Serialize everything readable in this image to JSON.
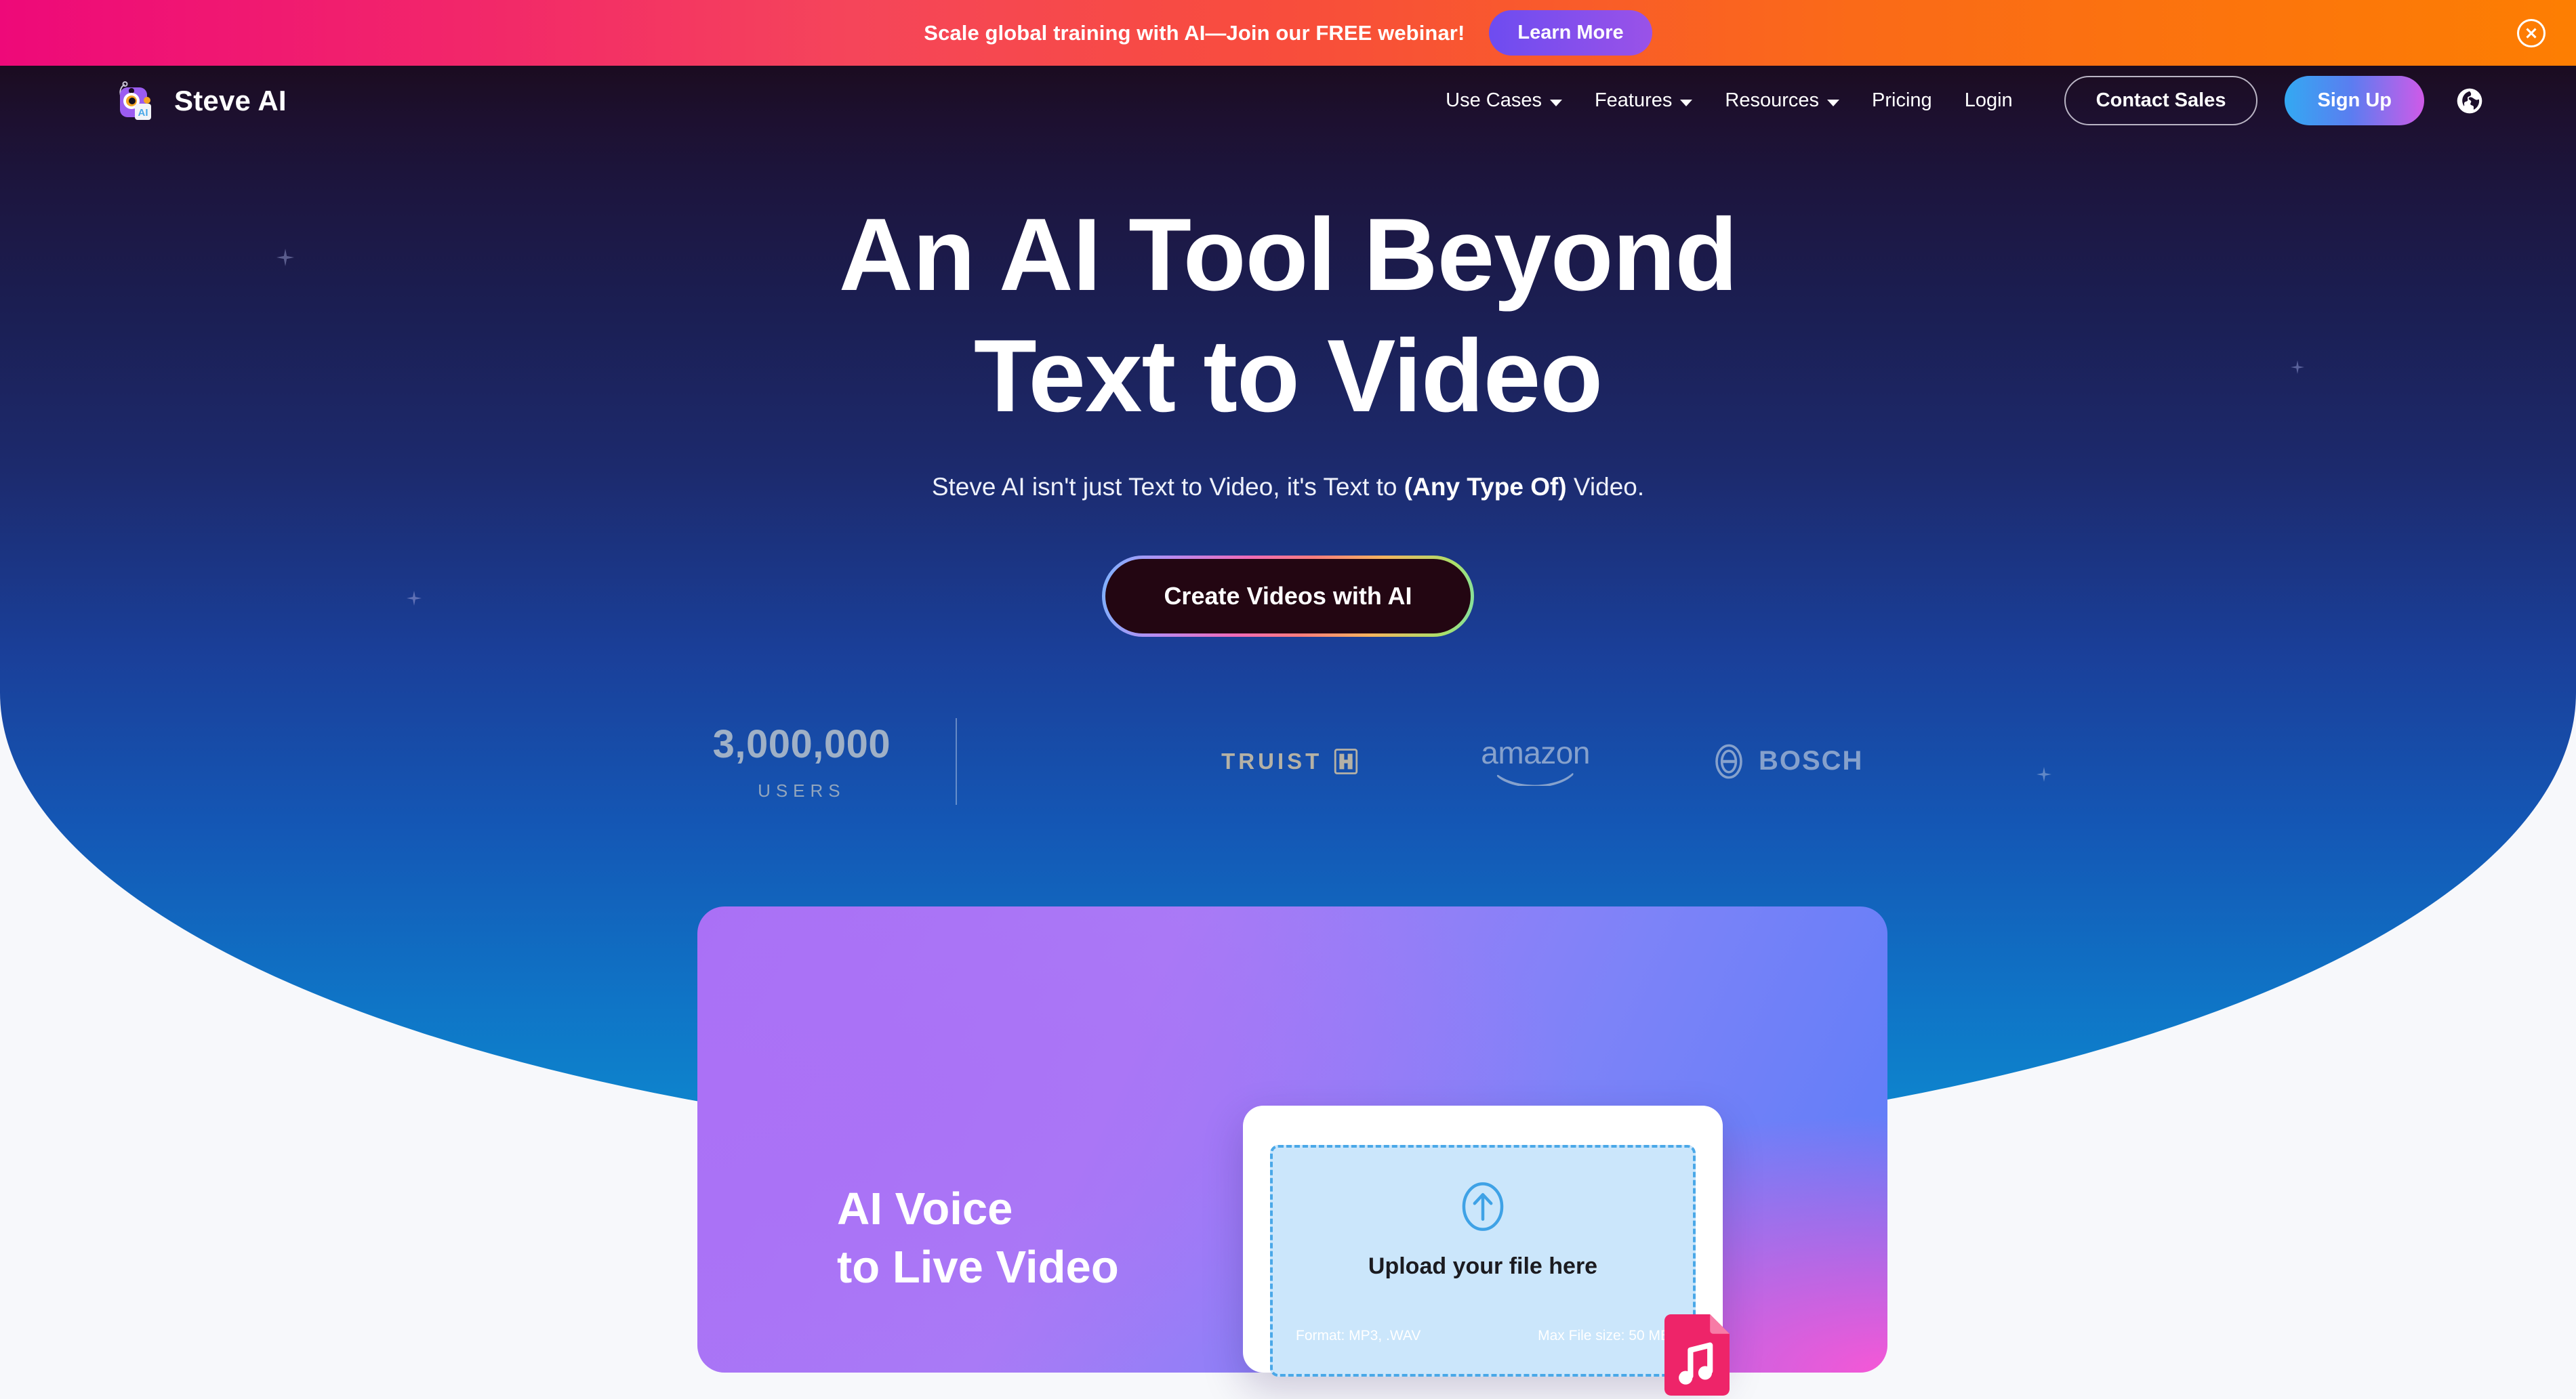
{
  "promo": {
    "message": "Scale global training with AI—Join our FREE webinar!",
    "button_label": "Learn More",
    "close_icon": "close-circle-icon",
    "gradient_from": "#ee0979",
    "gradient_to": "#fd7e02"
  },
  "nav": {
    "brand": "Steve AI",
    "brand_badge": "AI",
    "links": [
      {
        "label": "Use Cases",
        "has_dropdown": true
      },
      {
        "label": "Features",
        "has_dropdown": true
      },
      {
        "label": "Resources",
        "has_dropdown": true
      },
      {
        "label": "Pricing",
        "has_dropdown": false
      },
      {
        "label": "Login",
        "has_dropdown": false
      }
    ],
    "contact_sales": "Contact Sales",
    "sign_up": "Sign Up",
    "language_icon": "globe-icon"
  },
  "hero": {
    "headline_line1": "An AI Tool Beyond",
    "headline_line2": "Text to Video",
    "subtitle_part1": "Steve AI isn't just Text to Video, it's Text to ",
    "subtitle_bold": "(Any Type Of)",
    "subtitle_part2": " Video.",
    "cta_label": "Create Videos with AI"
  },
  "proof": {
    "stat_value": "3,000,000",
    "stat_label": "USERS",
    "logos": [
      {
        "name": "TRUIST",
        "color": "#d8c7a4"
      },
      {
        "name": "amazon",
        "color": "#9fb4d4"
      },
      {
        "name": "BOSCH",
        "color": "#9fb4d4"
      }
    ]
  },
  "feature": {
    "title_line1": "AI Voice",
    "title_line2": "to Live Video",
    "upload": {
      "icon": "upload-arrow-icon",
      "title": "Upload your file here",
      "format": "Format: MP3, .WAV",
      "max_size": "Max File size: 50 MB"
    },
    "file_icon": "music-file-icon"
  }
}
